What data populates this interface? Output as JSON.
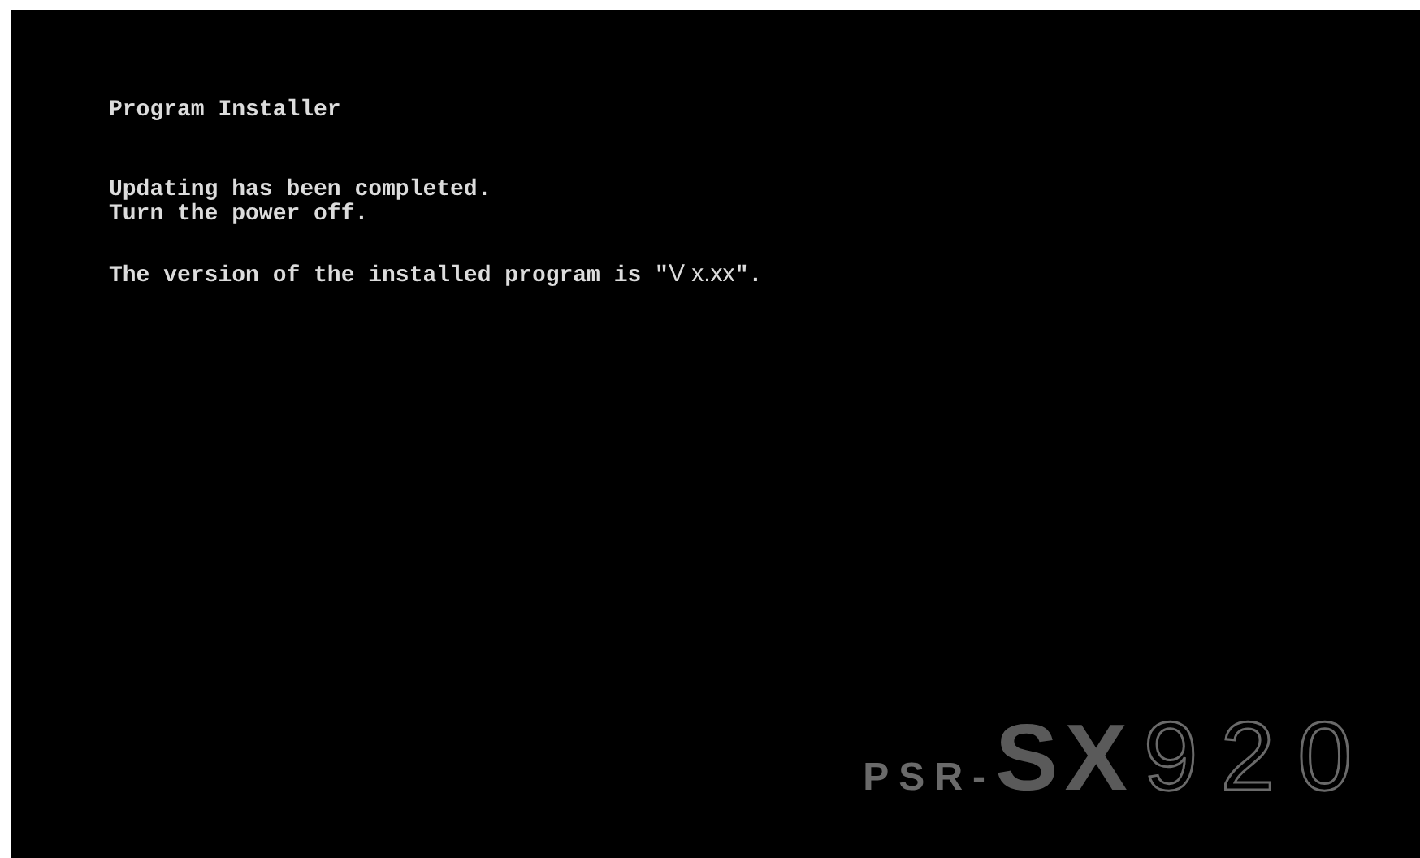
{
  "title": "Program Installer",
  "messages": [
    "Updating has been completed.",
    "Turn the power off."
  ],
  "version_line": {
    "before": "The version of the installed program is \"",
    "version": "V x.xx",
    "after": "\"."
  },
  "logo": {
    "prefix": "PSR-",
    "series": "SX",
    "model": "920"
  }
}
